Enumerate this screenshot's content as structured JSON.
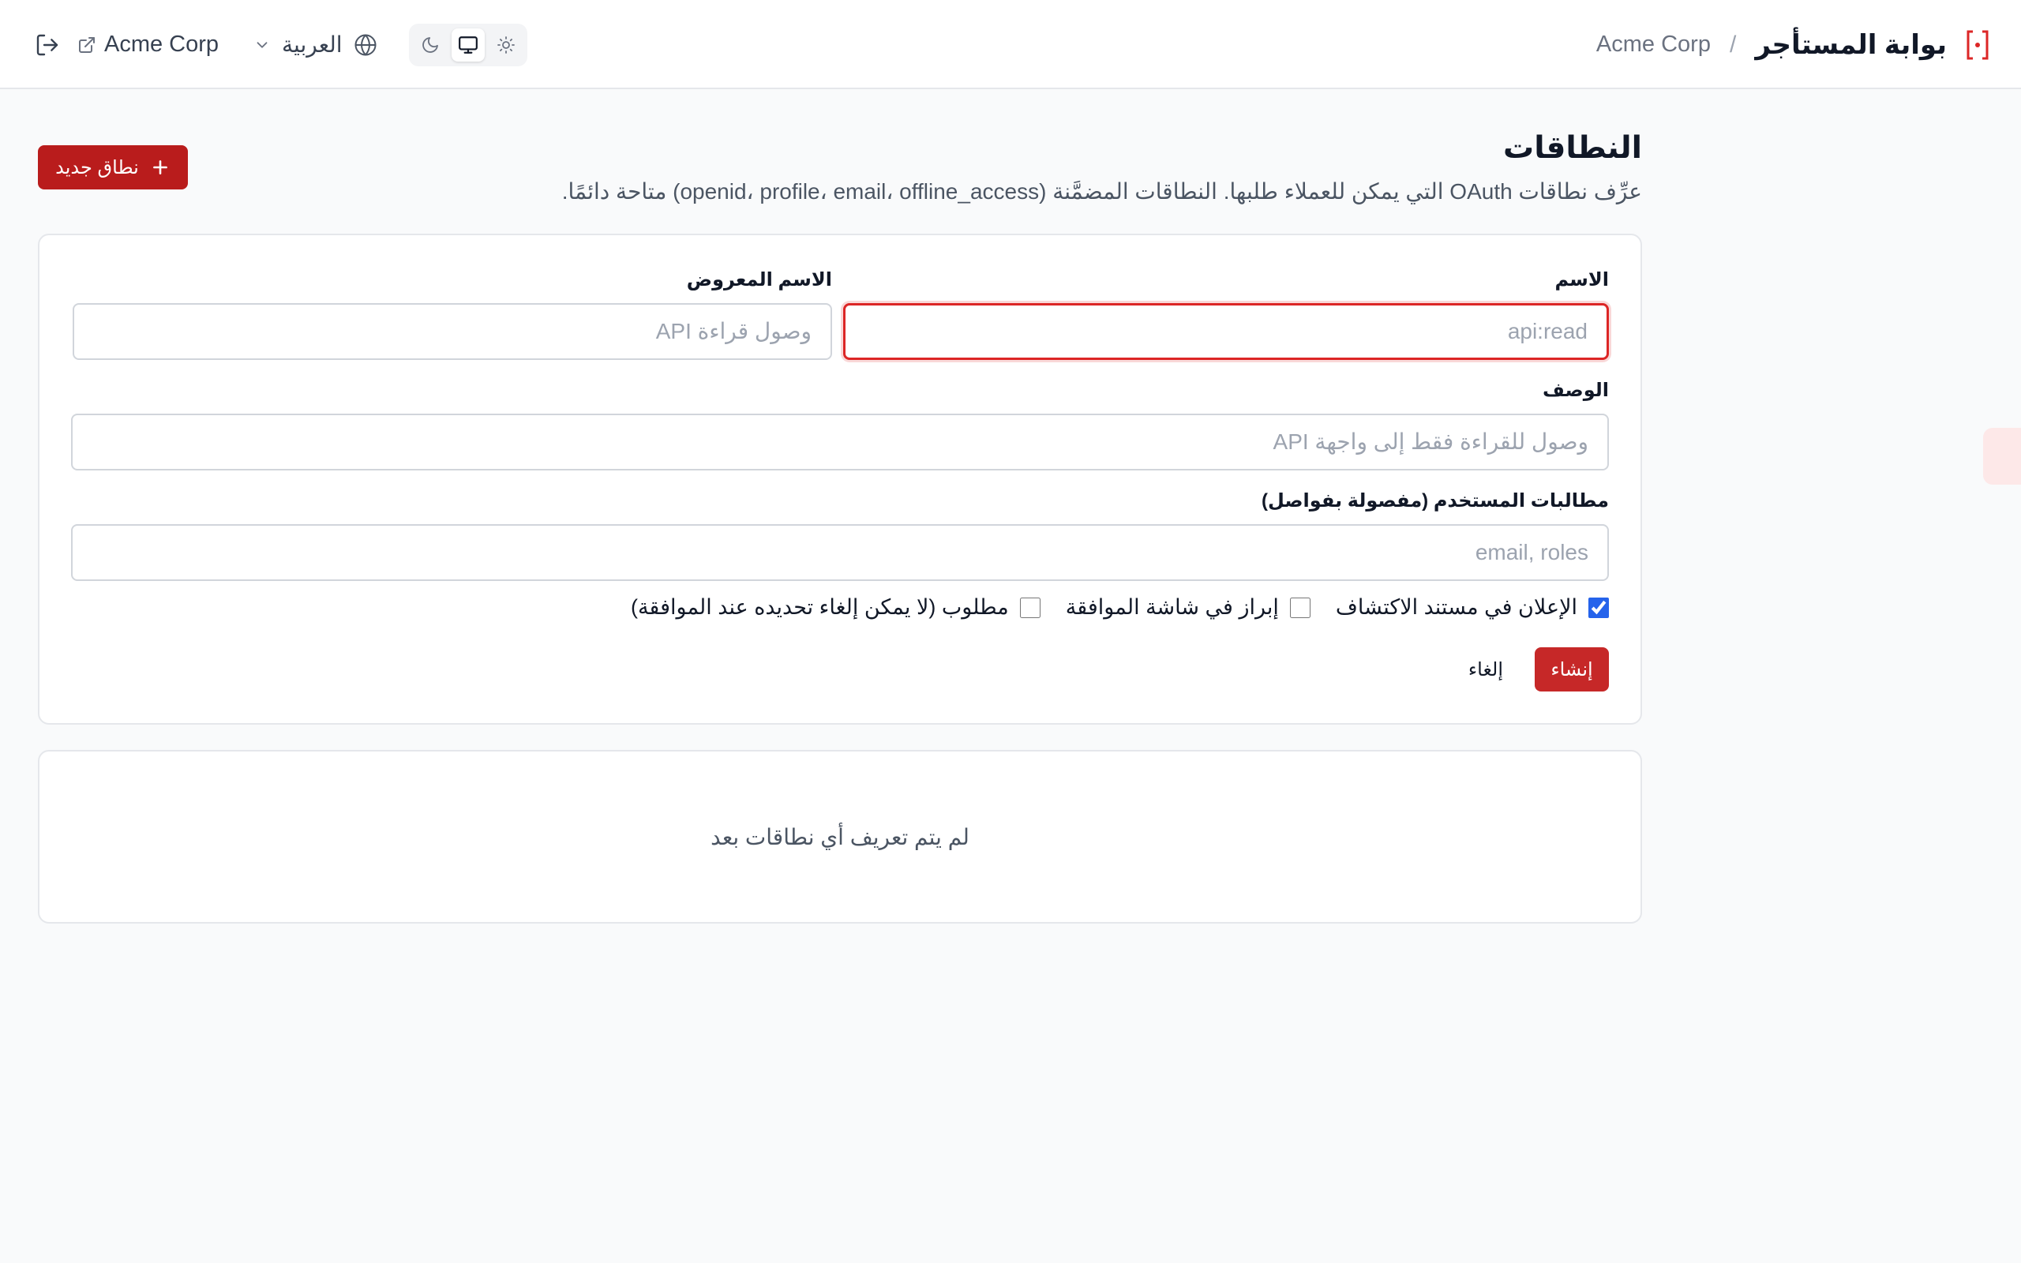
{
  "header": {
    "title": "بوابة المستأجر",
    "separator": "/",
    "tenant": "Acme Corp",
    "tenant_link": "Acme Corp",
    "language": "العربية",
    "logo_icon": "bracket-dot-logo-icon",
    "accent": "#dc2626"
  },
  "page": {
    "title": "النطاقات",
    "description": "عرِّف نطاقات OAuth التي يمكن للعملاء طلبها. النطاقات المضمَّنة (openid، profile، email، offline_access) متاحة دائمًا.",
    "new_button": "نطاق جديد"
  },
  "form": {
    "name_label": "الاسم",
    "name_placeholder": "api:read",
    "display_label": "الاسم المعروض",
    "display_placeholder": "وصول قراءة API",
    "desc_label": "الوصف",
    "desc_placeholder": "وصول للقراءة فقط إلى واجهة API",
    "claims_label": "مطالبات المستخدم (مفصولة بفواصل)",
    "claims_placeholder": "email, roles",
    "checkbox_discovery": "الإعلان في مستند الاكتشاف",
    "checkbox_consent": "إبراز في شاشة الموافقة",
    "checkbox_required": "مطلوب (لا يمكن إلغاء تحديده عند الموافقة)",
    "create_button": "إنشاء",
    "cancel_button": "إلغاء"
  },
  "empty_state": "لم يتم تعريف أي نطاقات بعد",
  "colors": {
    "primary": "#b91c1c",
    "checkbox": "#2563eb",
    "background": "#f9fafb"
  }
}
